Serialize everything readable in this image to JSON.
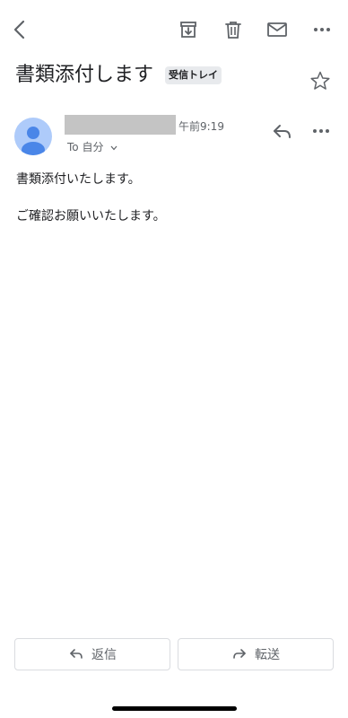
{
  "toolbar": {
    "back_icon": "chevron-left-icon",
    "archive_icon": "archive-icon",
    "delete_icon": "trash-icon",
    "unread_icon": "mail-icon",
    "more_icon": "more-horiz-icon"
  },
  "message": {
    "subject": "書類添付します",
    "label": "受信トレイ",
    "starred": false,
    "time": "午前9:19",
    "to_prefix": "To",
    "recipient": "自分",
    "body": [
      "書類添付いたします。",
      "ご確認お願いいたします。"
    ]
  },
  "actions": {
    "reply": "返信",
    "forward": "転送"
  },
  "colors": {
    "avatar_bg": "#aecbfa",
    "avatar_figure": "#4a86e8",
    "icon": "#5f6368",
    "label_chip": "#e8eaed"
  }
}
